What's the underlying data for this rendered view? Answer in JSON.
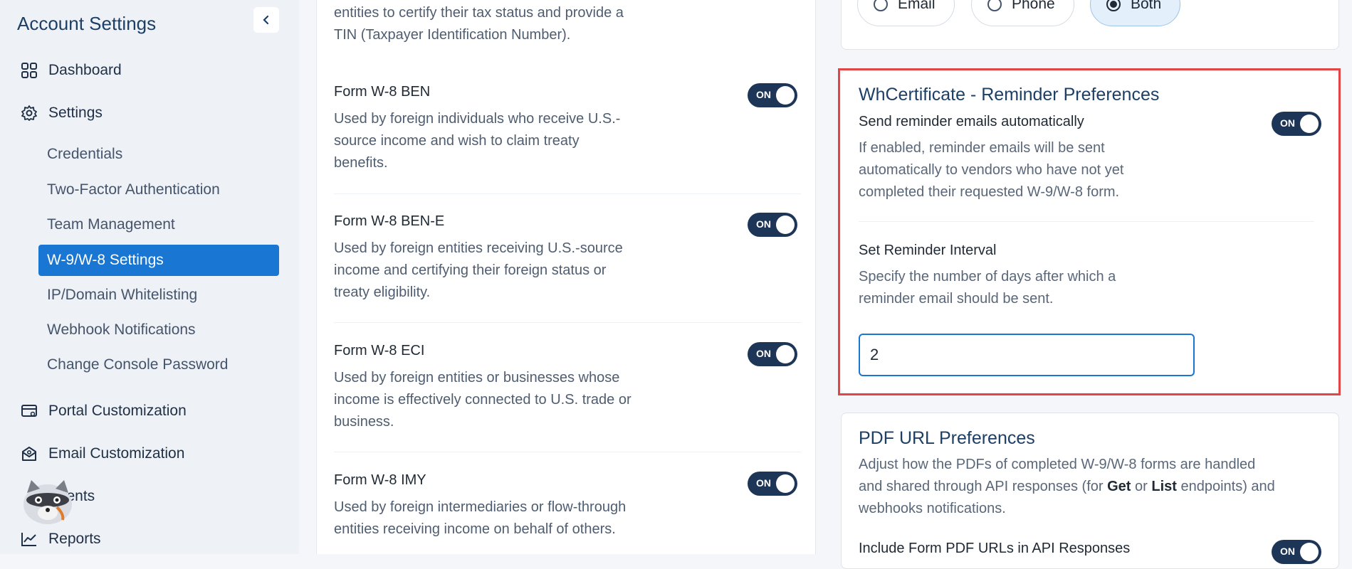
{
  "sidebar": {
    "title": "Account Settings",
    "collapse_icon": "chevron-left-icon",
    "nav": [
      {
        "label": "Dashboard",
        "icon": "grid-icon"
      },
      {
        "label": "Settings",
        "icon": "gear-icon"
      },
      {
        "label": "Portal Customization",
        "icon": "card-settings-icon"
      },
      {
        "label": "Email Customization",
        "icon": "envelope-icon"
      },
      {
        "label": "Payments",
        "icon": "payments-icon"
      },
      {
        "label": "Reports",
        "icon": "trend-icon"
      }
    ],
    "settings_sub": [
      "Credentials",
      "Two-Factor Authentication",
      "Team Management",
      "W-9/W-8 Settings",
      "IP/Domain Whitelisting",
      "Webhook Notifications",
      "Change Console Password"
    ],
    "active_sub": "W-9/W-8 Settings",
    "payments_visible_fragment": "ments"
  },
  "forms": {
    "intro": [
      "entities to certify their tax status and provide a",
      "TIN (Taxpayer Identification Number)."
    ],
    "items": [
      {
        "title": "Form W-8 BEN",
        "desc": [
          "Used by foreign individuals who receive U.S.-",
          "source income and wish to claim treaty",
          "benefits."
        ],
        "toggle": "ON"
      },
      {
        "title": "Form W-8 BEN-E",
        "desc": [
          "Used by foreign entities receiving U.S.-source",
          "income and certifying their foreign status or",
          "treaty eligibility."
        ],
        "toggle": "ON"
      },
      {
        "title": "Form W-8 ECI",
        "desc": [
          "Used by foreign entities or businesses whose",
          "income is effectively connected to U.S. trade or",
          "business."
        ],
        "toggle": "ON"
      },
      {
        "title": "Form W-8 IMY",
        "desc": [
          "Used by foreign intermediaries or flow-through",
          "entities receiving income on behalf of others."
        ],
        "toggle": "ON"
      }
    ]
  },
  "contact_method": {
    "options": [
      "Email",
      "Phone",
      "Both"
    ],
    "selected": "Both"
  },
  "reminder": {
    "title": "WhCertificate - Reminder Preferences",
    "auto_label": "Send reminder emails automatically",
    "auto_toggle": "ON",
    "auto_desc": [
      "If enabled, reminder emails will be sent",
      "automatically to vendors who have not yet",
      "completed their requested W-9/W-8 form."
    ],
    "interval_label": "Set Reminder Interval",
    "interval_desc": [
      "Specify the number of days after which a",
      "reminder email should be sent."
    ],
    "interval_value": "2"
  },
  "pdf": {
    "title": "PDF URL Preferences",
    "desc_line1": "Adjust how the PDFs of completed W-9/W-8 forms are handled",
    "desc_line2_a": "and shared through API responses (for ",
    "desc_line2_b": "Get",
    "desc_line2_c": " or ",
    "desc_line2_d": "List",
    "desc_line2_e": " endpoints) and",
    "desc_line3": "webhooks notifications.",
    "include_label": "Include Form PDF URLs in API Responses",
    "include_toggle": "ON"
  },
  "colors": {
    "accent": "#1976d2",
    "toggle": "#1d3557",
    "highlight": "#e04646",
    "title": "#1d3f66"
  }
}
